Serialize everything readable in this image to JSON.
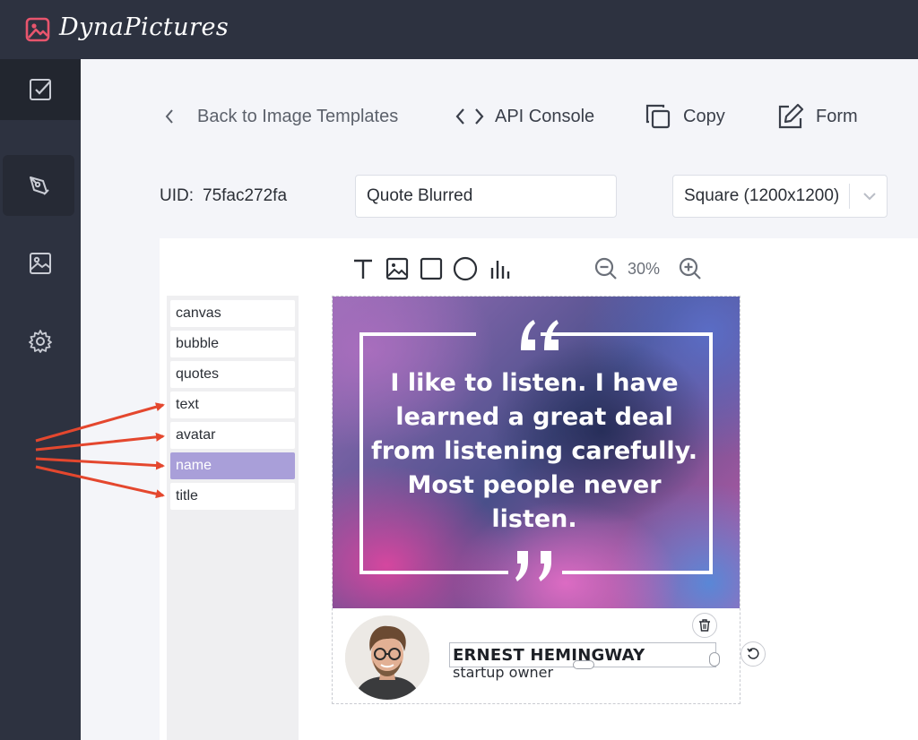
{
  "app": {
    "name": "DynaPictures",
    "logo_icon": "image-icon",
    "accent": "#e8556d"
  },
  "sidebar": {
    "items": [
      {
        "icon": "checkbox-icon",
        "active": "top"
      },
      {
        "icon": "pen-tool-icon",
        "active": "current"
      },
      {
        "icon": "image-icon"
      },
      {
        "icon": "gear-icon"
      }
    ]
  },
  "toolbar": {
    "back_label": "Back to Image Templates",
    "api_label": "API Console",
    "copy_label": "Copy",
    "form_label": "Form"
  },
  "template": {
    "uid_label": "UID:",
    "uid_value": "75fac272fa",
    "name_value": "Quote Blurred",
    "size_selected": "Square (1200x1200)"
  },
  "editor_tools": {
    "tools": [
      "text-tool-icon",
      "image-tool-icon",
      "rectangle-tool-icon",
      "circle-tool-icon",
      "chart-tool-icon"
    ],
    "zoom": "30%"
  },
  "layers": {
    "items": [
      "canvas",
      "bubble",
      "quotes",
      "text",
      "avatar",
      "name",
      "title"
    ],
    "selected": "name"
  },
  "canvas": {
    "quote_text": "I like to listen. I have learned a great deal from listening carefully. Most people never listen.",
    "name": "ERNEST HEMINGWAY",
    "title": "startup owner"
  },
  "annotation_color": "#e4472e"
}
